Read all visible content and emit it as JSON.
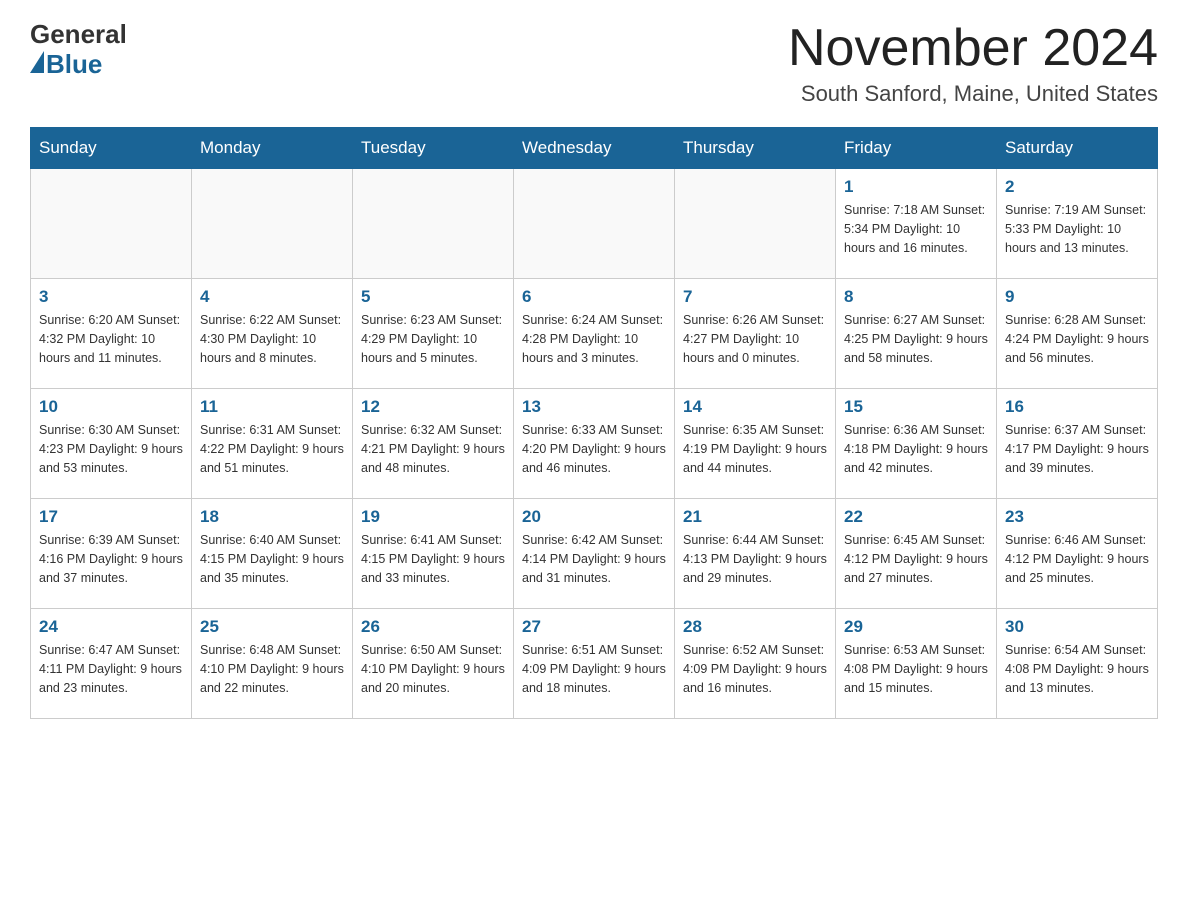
{
  "header": {
    "logo_general": "General",
    "logo_blue": "Blue",
    "month_title": "November 2024",
    "location": "South Sanford, Maine, United States"
  },
  "days_of_week": [
    "Sunday",
    "Monday",
    "Tuesday",
    "Wednesday",
    "Thursday",
    "Friday",
    "Saturday"
  ],
  "weeks": [
    [
      {
        "day": "",
        "info": ""
      },
      {
        "day": "",
        "info": ""
      },
      {
        "day": "",
        "info": ""
      },
      {
        "day": "",
        "info": ""
      },
      {
        "day": "",
        "info": ""
      },
      {
        "day": "1",
        "info": "Sunrise: 7:18 AM\nSunset: 5:34 PM\nDaylight: 10 hours and 16 minutes."
      },
      {
        "day": "2",
        "info": "Sunrise: 7:19 AM\nSunset: 5:33 PM\nDaylight: 10 hours and 13 minutes."
      }
    ],
    [
      {
        "day": "3",
        "info": "Sunrise: 6:20 AM\nSunset: 4:32 PM\nDaylight: 10 hours and 11 minutes."
      },
      {
        "day": "4",
        "info": "Sunrise: 6:22 AM\nSunset: 4:30 PM\nDaylight: 10 hours and 8 minutes."
      },
      {
        "day": "5",
        "info": "Sunrise: 6:23 AM\nSunset: 4:29 PM\nDaylight: 10 hours and 5 minutes."
      },
      {
        "day": "6",
        "info": "Sunrise: 6:24 AM\nSunset: 4:28 PM\nDaylight: 10 hours and 3 minutes."
      },
      {
        "day": "7",
        "info": "Sunrise: 6:26 AM\nSunset: 4:27 PM\nDaylight: 10 hours and 0 minutes."
      },
      {
        "day": "8",
        "info": "Sunrise: 6:27 AM\nSunset: 4:25 PM\nDaylight: 9 hours and 58 minutes."
      },
      {
        "day": "9",
        "info": "Sunrise: 6:28 AM\nSunset: 4:24 PM\nDaylight: 9 hours and 56 minutes."
      }
    ],
    [
      {
        "day": "10",
        "info": "Sunrise: 6:30 AM\nSunset: 4:23 PM\nDaylight: 9 hours and 53 minutes."
      },
      {
        "day": "11",
        "info": "Sunrise: 6:31 AM\nSunset: 4:22 PM\nDaylight: 9 hours and 51 minutes."
      },
      {
        "day": "12",
        "info": "Sunrise: 6:32 AM\nSunset: 4:21 PM\nDaylight: 9 hours and 48 minutes."
      },
      {
        "day": "13",
        "info": "Sunrise: 6:33 AM\nSunset: 4:20 PM\nDaylight: 9 hours and 46 minutes."
      },
      {
        "day": "14",
        "info": "Sunrise: 6:35 AM\nSunset: 4:19 PM\nDaylight: 9 hours and 44 minutes."
      },
      {
        "day": "15",
        "info": "Sunrise: 6:36 AM\nSunset: 4:18 PM\nDaylight: 9 hours and 42 minutes."
      },
      {
        "day": "16",
        "info": "Sunrise: 6:37 AM\nSunset: 4:17 PM\nDaylight: 9 hours and 39 minutes."
      }
    ],
    [
      {
        "day": "17",
        "info": "Sunrise: 6:39 AM\nSunset: 4:16 PM\nDaylight: 9 hours and 37 minutes."
      },
      {
        "day": "18",
        "info": "Sunrise: 6:40 AM\nSunset: 4:15 PM\nDaylight: 9 hours and 35 minutes."
      },
      {
        "day": "19",
        "info": "Sunrise: 6:41 AM\nSunset: 4:15 PM\nDaylight: 9 hours and 33 minutes."
      },
      {
        "day": "20",
        "info": "Sunrise: 6:42 AM\nSunset: 4:14 PM\nDaylight: 9 hours and 31 minutes."
      },
      {
        "day": "21",
        "info": "Sunrise: 6:44 AM\nSunset: 4:13 PM\nDaylight: 9 hours and 29 minutes."
      },
      {
        "day": "22",
        "info": "Sunrise: 6:45 AM\nSunset: 4:12 PM\nDaylight: 9 hours and 27 minutes."
      },
      {
        "day": "23",
        "info": "Sunrise: 6:46 AM\nSunset: 4:12 PM\nDaylight: 9 hours and 25 minutes."
      }
    ],
    [
      {
        "day": "24",
        "info": "Sunrise: 6:47 AM\nSunset: 4:11 PM\nDaylight: 9 hours and 23 minutes."
      },
      {
        "day": "25",
        "info": "Sunrise: 6:48 AM\nSunset: 4:10 PM\nDaylight: 9 hours and 22 minutes."
      },
      {
        "day": "26",
        "info": "Sunrise: 6:50 AM\nSunset: 4:10 PM\nDaylight: 9 hours and 20 minutes."
      },
      {
        "day": "27",
        "info": "Sunrise: 6:51 AM\nSunset: 4:09 PM\nDaylight: 9 hours and 18 minutes."
      },
      {
        "day": "28",
        "info": "Sunrise: 6:52 AM\nSunset: 4:09 PM\nDaylight: 9 hours and 16 minutes."
      },
      {
        "day": "29",
        "info": "Sunrise: 6:53 AM\nSunset: 4:08 PM\nDaylight: 9 hours and 15 minutes."
      },
      {
        "day": "30",
        "info": "Sunrise: 6:54 AM\nSunset: 4:08 PM\nDaylight: 9 hours and 13 minutes."
      }
    ]
  ]
}
